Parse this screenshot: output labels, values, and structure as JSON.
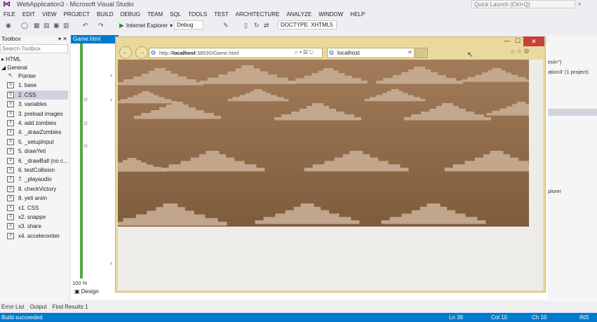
{
  "vs": {
    "title": "WebApplication3 - Microsoft Visual Studio",
    "quick_launch": "Quick Launch (Ctrl+Q)",
    "menu": [
      "FILE",
      "EDIT",
      "VIEW",
      "PROJECT",
      "BUILD",
      "DEBUG",
      "TEAM",
      "SQL",
      "TOOLS",
      "TEST",
      "ARCHITECTURE",
      "ANALYZE",
      "WINDOW",
      "HELP"
    ],
    "toolbar": {
      "run_label": "Internet Explorer",
      "config": "Debug",
      "doctype": "DOCTYPE: XHTML5"
    }
  },
  "toolbox": {
    "title": "Toolbox",
    "pin": "▾ ✕",
    "search_placeholder": "Search Toolbox",
    "group_html": "▸ HTML",
    "group_general": "◢ General",
    "items": [
      {
        "label": "Pointer"
      },
      {
        "label": "1. base"
      },
      {
        "label": "2. CSS"
      },
      {
        "label": "3. variables"
      },
      {
        "label": "3. preload images"
      },
      {
        "label": "4. add zombies"
      },
      {
        "label": "4. _drawZombies"
      },
      {
        "label": "5. _setupInput"
      },
      {
        "label": "5. drawYeti"
      },
      {
        "label": "6. _drawBall (no c..."
      },
      {
        "label": "6. testCollision"
      },
      {
        "label": "7. _playaudio"
      },
      {
        "label": "8. checkVictory"
      },
      {
        "label": "8. yeti anim"
      },
      {
        "label": "x1. CSS"
      },
      {
        "label": "x2. snappe"
      },
      {
        "label": "x3. share"
      },
      {
        "label": "x4. acceleromter"
      }
    ]
  },
  "editor": {
    "doc_tab": "Game.html",
    "zoom": "100 %",
    "design_tab": "Design"
  },
  "solution": {
    "line1": "tml=\")",
    "line2": "ation3' (1 project)",
    "line3": "plorer"
  },
  "bottom_tabs": [
    "Error List",
    "Output",
    "Find Results 1"
  ],
  "status": {
    "message": "Build succeeded",
    "ln": "Ln 39",
    "col": "Col 10",
    "ch": "Ch 10",
    "ins": "INS"
  },
  "ie": {
    "url_prefix": "http://",
    "url_host": "localhost",
    "url_rest": ":38530/Game.html",
    "tab_title": "localhost",
    "min": "—",
    "max": "☐",
    "close": "✕"
  },
  "colors": {
    "vs_accent": "#007acc",
    "ie_frame": "#e9d99d",
    "game_bg": "#8a6a48",
    "cloud": "#c8ad94"
  }
}
